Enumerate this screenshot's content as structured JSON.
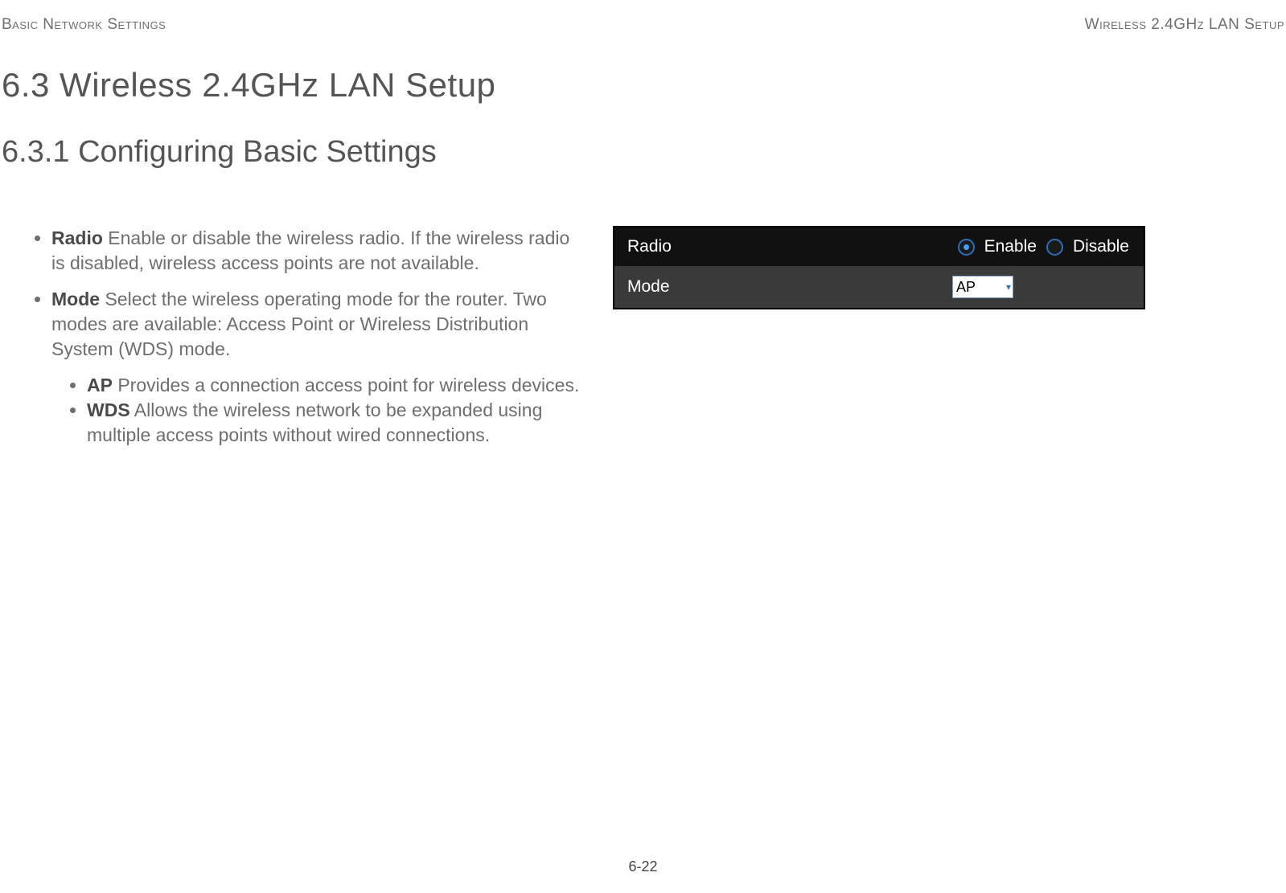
{
  "header": {
    "left": "Basic Network Settings",
    "right": "Wireless 2.4GHz LAN Setup"
  },
  "titles": {
    "section": "6.3 Wireless 2.4GHz LAN Setup",
    "subsection": "6.3.1 Configuring Basic Settings"
  },
  "descriptions": {
    "radio": {
      "term": "Radio",
      "text": "  Enable or disable the wireless radio. If the wireless radio is disabled, wireless access points are not available."
    },
    "mode": {
      "term": "Mode",
      "text": "  Select the wireless operating mode for the router. Two modes are available: Access Point or Wireless Distribution System (WDS) mode.",
      "ap": {
        "term": "AP",
        "text": "  Provides a connection access point for wireless devices."
      },
      "wds": {
        "term": "WDS",
        "text": "  Allows the wireless network to be expanded using multiple access points without wired connections."
      }
    }
  },
  "inset": {
    "radio": {
      "label": "Radio",
      "enable": "Enable",
      "disable": "Disable"
    },
    "mode": {
      "label": "Mode",
      "value": "AP"
    }
  },
  "footer": {
    "page": "6-22"
  }
}
